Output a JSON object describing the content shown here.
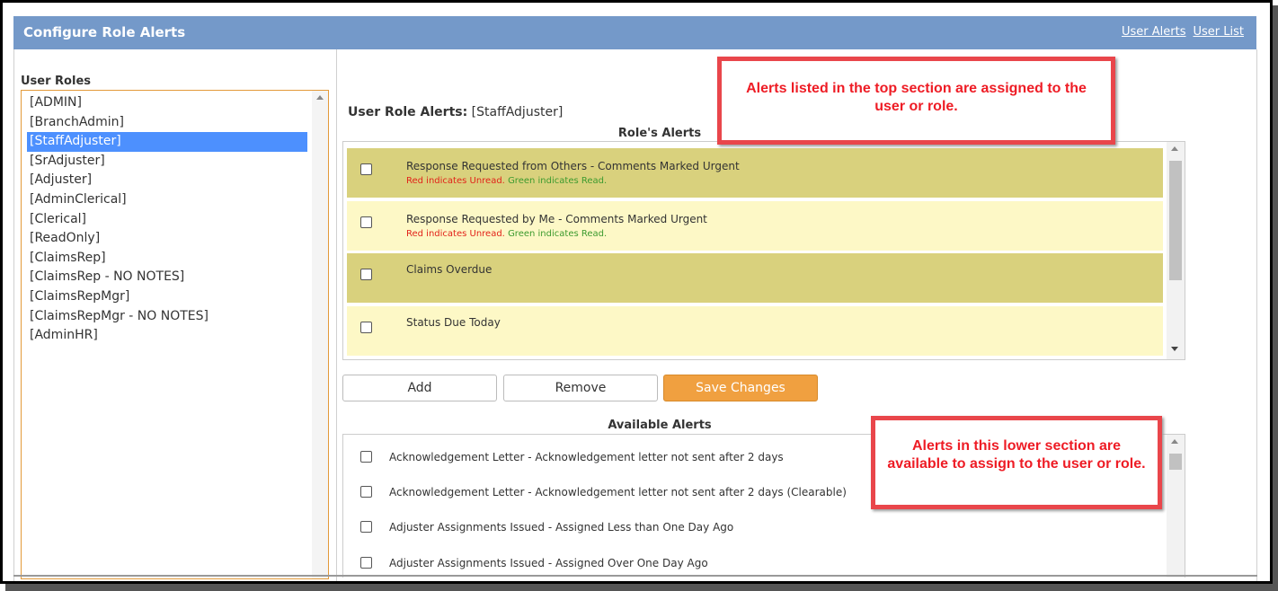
{
  "header": {
    "title": "Configure Role Alerts",
    "links": [
      "User Alerts",
      "User List"
    ]
  },
  "roles": {
    "label": "User Roles",
    "items": [
      "[ADMIN]",
      "[BranchAdmin]",
      "[StaffAdjuster]",
      "[SrAdjuster]",
      "[Adjuster]",
      "[AdminClerical]",
      "[Clerical]",
      "[ReadOnly]",
      "[ClaimsRep]",
      "[ClaimsRep - NO NOTES]",
      "[ClaimsRepMgr]",
      "[ClaimsRepMgr - NO NOTES]",
      "[AdminHR]"
    ],
    "selected": "[StaffAdjuster]"
  },
  "role_alerts": {
    "label": "User Role Alerts:",
    "role": "[StaffAdjuster]",
    "section_title": "Role's Alerts",
    "legend_red": "Red indicates Unread.",
    "legend_green": "Green indicates Read.",
    "items": [
      {
        "name": "Response Requested from Others - Comments Marked Urgent",
        "has_legend": true,
        "shade": "dark"
      },
      {
        "name": "Response Requested by Me - Comments Marked Urgent",
        "has_legend": true,
        "shade": "light"
      },
      {
        "name": "Claims Overdue",
        "has_legend": false,
        "shade": "dark"
      },
      {
        "name": "Status Due Today",
        "has_legend": false,
        "shade": "light"
      }
    ]
  },
  "buttons": {
    "add": "Add",
    "remove": "Remove",
    "save": "Save Changes"
  },
  "available": {
    "section_title": "Available Alerts",
    "items": [
      "Acknowledgement Letter - Acknowledgement letter not sent after 2 days",
      "Acknowledgement Letter - Acknowledgement letter not sent after 2 days (Clearable)",
      "Adjuster Assignments Issued - Assigned Less than One Day Ago",
      "Adjuster Assignments Issued - Assigned Over One Day Ago"
    ]
  },
  "callouts": {
    "top": "Alerts listed in the top section are assigned to the user or role.",
    "bottom": "Alerts in this lower section are available to assign to the user or role."
  },
  "colors": {
    "header_bg": "#7499c9",
    "row_dark": "#d9d17d",
    "row_light": "#fdf8c6",
    "selected_role": "#4d90fe",
    "save_button": "#f0a040",
    "callout": "#ee1c25"
  }
}
